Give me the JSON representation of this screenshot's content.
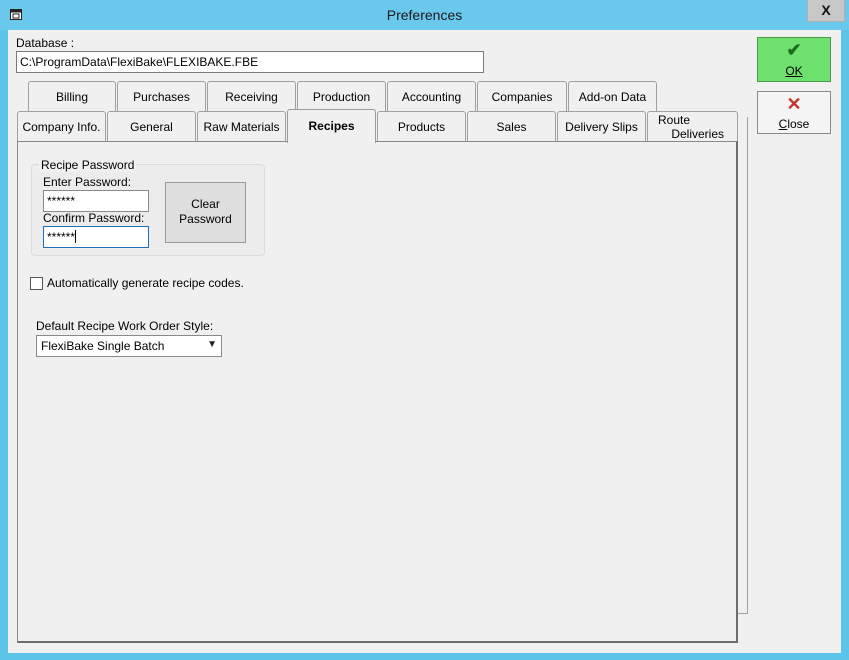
{
  "window": {
    "title": "Preferences",
    "close_glyph": "X",
    "icon": "window-icon"
  },
  "database": {
    "label": "Database :",
    "path": "C:\\ProgramData\\FlexiBake\\FLEXIBAKE.FBE"
  },
  "tabs_row1": [
    {
      "label": "Billing"
    },
    {
      "label": "Purchases"
    },
    {
      "label": "Receiving"
    },
    {
      "label": "Production"
    },
    {
      "label": "Accounting"
    },
    {
      "label": "Companies"
    },
    {
      "label": "Add-on Data"
    }
  ],
  "tabs_row2": [
    {
      "label": "Company Info."
    },
    {
      "label": "General"
    },
    {
      "label": "Raw Materials"
    },
    {
      "label": "Recipes"
    },
    {
      "label": "Products"
    },
    {
      "label": "Sales"
    },
    {
      "label": "Delivery Slips"
    },
    {
      "label": "Route\n    Deliveries"
    }
  ],
  "active_tab": "Recipes",
  "recipes": {
    "password_group_title": "Recipe Password",
    "enter_password_label": "Enter Password:",
    "enter_password_value": "******",
    "confirm_password_label": "Confirm Password:",
    "confirm_password_value": "******",
    "clear_password_line1": "Clear",
    "clear_password_line2": "Password",
    "auto_generate_label": "Automatically generate recipe codes.",
    "auto_generate_checked": false,
    "work_order_style_label": "Default Recipe Work Order Style:",
    "work_order_style_value": "FlexiBake Single Batch"
  },
  "buttons": {
    "ok_label": "OK",
    "ok_icon": "check-icon",
    "close_label": "Close",
    "close_icon": "x-icon"
  }
}
